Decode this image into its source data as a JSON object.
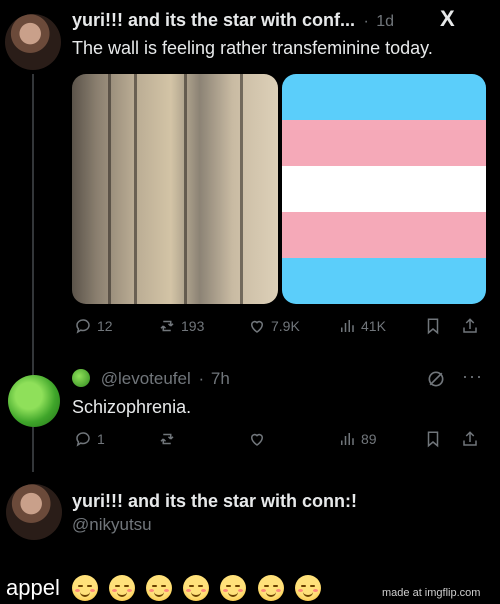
{
  "tweet1": {
    "display_name": "yuri!!! and its the star with conf...",
    "dot": "·",
    "time": "1d",
    "platform_logo": "X",
    "text": "The wall is feeling rather transfeminine today.",
    "image_left": "wall-photo",
    "image_right": "trans-flag",
    "flag_colors": [
      "#5bcefa",
      "#f5a9b8",
      "#ffffff",
      "#f5a9b8",
      "#5bcefa"
    ],
    "stats": {
      "replies": "12",
      "reposts": "193",
      "likes": "7.9K",
      "views": "41K"
    }
  },
  "reply": {
    "avatar_icon": "green-apple-icon",
    "badge_icon": "apple-emoji-icon",
    "handle": "@levoteufel",
    "dot": "·",
    "time": "7h",
    "text": "Schizophrenia.",
    "stats": {
      "replies": "1",
      "views": "89"
    }
  },
  "tweet3": {
    "display_name": "yuri!!! and its the star with conn:!",
    "handle": "@nikyutsu"
  },
  "footer": {
    "caption": "appel",
    "emoji_count_note": "relieved-face-icon",
    "watermark": "made at imgflip.com"
  }
}
